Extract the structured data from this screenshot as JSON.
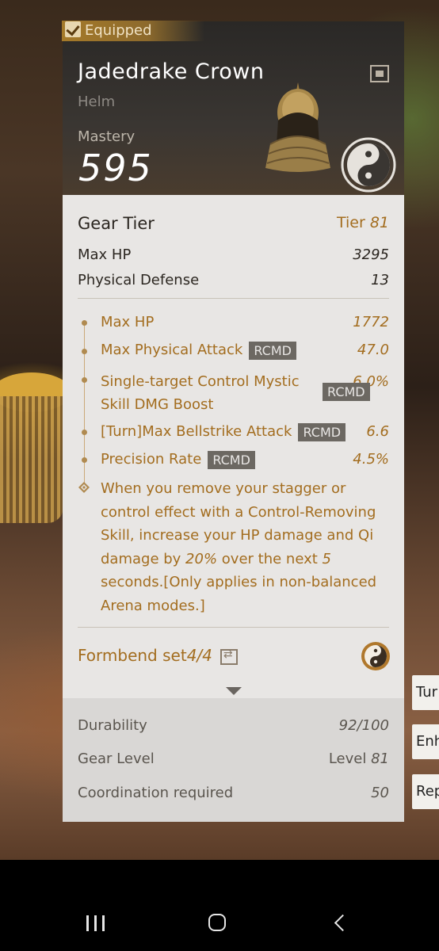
{
  "item": {
    "equipped_label": "Equipped",
    "name": "Jadedrake Crown",
    "type": "Helm",
    "mastery_label": "Mastery",
    "mastery_value": "595"
  },
  "base_stats": {
    "gear_tier_label": "Gear Tier",
    "gear_tier_prefix": "Tier",
    "gear_tier_value": "81",
    "rows": [
      {
        "label": "Max HP",
        "value": "3295"
      },
      {
        "label": "Physical Defense",
        "value": "13"
      }
    ]
  },
  "bonus_stats": [
    {
      "label": "Max HP",
      "value": "1772",
      "rcmd": ""
    },
    {
      "label": "Max Physical Attack",
      "value": "47.0",
      "rcmd": "RCMD"
    },
    {
      "label": "Single-target Control Mystic Skill DMG Boost",
      "value": "6.0%",
      "rcmd": "RCMD"
    },
    {
      "label": "[Turn]Max Bellstrike Attack",
      "value": "6.6",
      "rcmd": "RCMD"
    },
    {
      "label": "Precision Rate",
      "value": "4.5%",
      "rcmd": "RCMD"
    }
  ],
  "special_effect": {
    "text_1": "When you remove your stagger or control effect with a Control-Removing Skill, increase your HP damage and Qi damage by ",
    "pct": "20%",
    "text_2": " over the next ",
    "secs": "5",
    "text_3": " seconds.[Only applies in non-balanced Arena modes.]"
  },
  "set": {
    "label": "Formbend set",
    "count": "4/4"
  },
  "footer": {
    "durability_label": "Durability",
    "durability_value": "92/100",
    "gear_level_label": "Gear Level",
    "gear_level_prefix": "Level",
    "gear_level_value": "81",
    "coordination_label": "Coordination required",
    "coordination_value": "50"
  },
  "side_buttons": [
    "Tur",
    "Enh",
    "Rep"
  ],
  "colors": {
    "accent_gold": "#a36d1f",
    "panel_bg": "#e8e6e4",
    "rcmd_bg": "#6c6862"
  },
  "icons": [
    "check-icon",
    "chest-icon",
    "yin-yang-icon",
    "swap-icon",
    "diamond-bullet-icon",
    "arrow-down-icon",
    "nav-recent-icon",
    "nav-home-icon",
    "nav-back-icon"
  ]
}
